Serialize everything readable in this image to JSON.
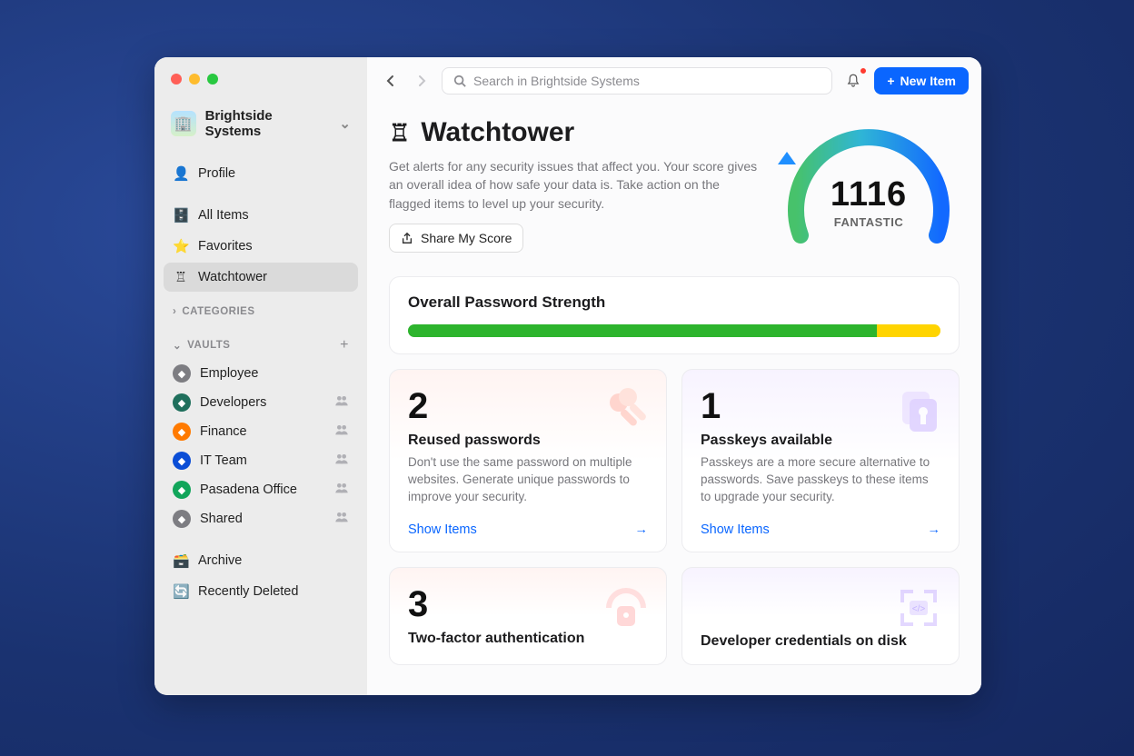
{
  "account": {
    "name": "Brightside Systems",
    "icon": "🏢"
  },
  "sidebar": {
    "profile": "Profile",
    "nav": [
      {
        "icon": "🗄️",
        "label": "All Items"
      },
      {
        "icon": "⭐",
        "label": "Favorites"
      },
      {
        "icon": "♖",
        "label": "Watchtower",
        "active": true
      }
    ],
    "categories_label": "CATEGORIES",
    "vaults_label": "VAULTS",
    "vaults": [
      {
        "label": "Employee",
        "color": "#7d7d82",
        "shared": false
      },
      {
        "label": "Developers",
        "color": "#1f6f5c",
        "shared": true
      },
      {
        "label": "Finance",
        "color": "#ff7a00",
        "shared": true
      },
      {
        "label": "IT Team",
        "color": "#0a4dd6",
        "shared": true
      },
      {
        "label": "Pasadena Office",
        "color": "#11a55a",
        "shared": true
      },
      {
        "label": "Shared",
        "color": "#7d7d82",
        "shared": true
      }
    ],
    "archive": "Archive",
    "deleted": "Recently Deleted"
  },
  "topbar": {
    "search_placeholder": "Search in Brightside Systems",
    "new_item": "New Item"
  },
  "page": {
    "title": "Watchtower",
    "title_icon": "♖",
    "description": "Get alerts for any security issues that affect you. Your score gives an overall idea of how safe your data is. Take action on the flagged items to level up your security.",
    "share_label": "Share My Score",
    "score": "1116",
    "score_label": "FANTASTIC"
  },
  "strength": {
    "title": "Overall Password Strength",
    "green_pct": 88,
    "yellow_pct": 12
  },
  "tiles": [
    {
      "count": "2",
      "title": "Reused passwords",
      "body": "Don't use the same password on multiple websites. Generate unique passwords to improve your security.",
      "cta": "Show Items",
      "tone": "pink"
    },
    {
      "count": "1",
      "title": "Passkeys available",
      "body": "Passkeys are a more secure alternative to passwords. Save passkeys to these items to upgrade your security.",
      "cta": "Show Items",
      "tone": "purple"
    },
    {
      "count": "3",
      "title": "Two-factor authentication",
      "body": "",
      "cta": "",
      "tone": "pink"
    },
    {
      "count": "",
      "title": "Developer credentials on disk",
      "body": "",
      "cta": "",
      "tone": "purple"
    }
  ]
}
